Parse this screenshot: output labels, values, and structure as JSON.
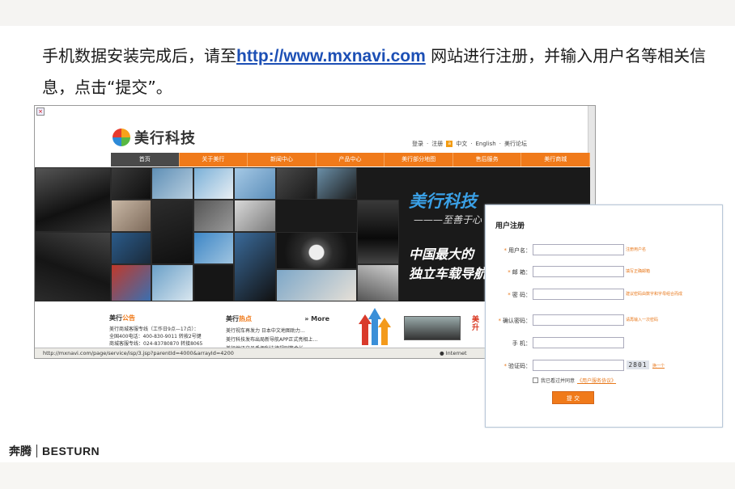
{
  "instruction": {
    "before_link": "手机数据安装完成后，请至",
    "link": "http://www.mxnavi.com",
    "after_link": " 网站进行注册，并输入用户名等相关信息，点击“提交”。"
  },
  "browser": {
    "logo_text": "美行科技",
    "top_links": [
      "登录",
      "注册",
      "中文",
      "English",
      "美行论坛"
    ],
    "nav": [
      "首页",
      "关于美行",
      "新闻中心",
      "产品中心",
      "美行部分地图",
      "售后服务",
      "美行商城"
    ],
    "banner": {
      "slogan": "美行科技",
      "slogan_sub": "———至善于心",
      "line1": "中国最大的",
      "line2": "独立车载导航"
    },
    "section1": {
      "title_a": "美行",
      "title_b": "公告",
      "lines": [
        "美行商城客服专线（工作日9点—17点）：",
        "全国400电话：400-830-9011 转按2号键",
        "商城客服专线：024-83780870 转接8065"
      ]
    },
    "section2": {
      "title_a": "美行",
      "title_b": "热点",
      "more": "More",
      "lines": [
        "美行视车再发力 日本中文地图助力…",
        "美行科技发布出局新导航APP正式亮相上…",
        "美行地讯文员手便利法律规则等会长…"
      ]
    },
    "status_url": "http://mxnavi.com/page/service/isp/3.jsp?parentId=4000&arrayId=4200",
    "status_zone": "Internet"
  },
  "register": {
    "title": "用户注册",
    "fields": [
      {
        "label": "用户名：",
        "hint": "注册用户名"
      },
      {
        "label": "邮  箱：",
        "hint": "填写正确邮箱"
      },
      {
        "label": "密  码：",
        "hint": "建议密码由数字和字母组合而成"
      },
      {
        "label": "确认密码：",
        "hint": "请再输入一次密码"
      },
      {
        "label": "手  机：",
        "hint": ""
      },
      {
        "label": "验证码：",
        "hint": ""
      }
    ],
    "captcha": "2801",
    "refresh": "换一个",
    "agree_text": "我已看过并同意",
    "agree_link": "《用户服务协议》",
    "submit": "提 交"
  },
  "brand": {
    "cn": "奔腾",
    "en": "BESTURN"
  },
  "colors": {
    "accent": "#f07a1a",
    "link": "#1c4fb5",
    "slogan": "#3aa0e6"
  }
}
